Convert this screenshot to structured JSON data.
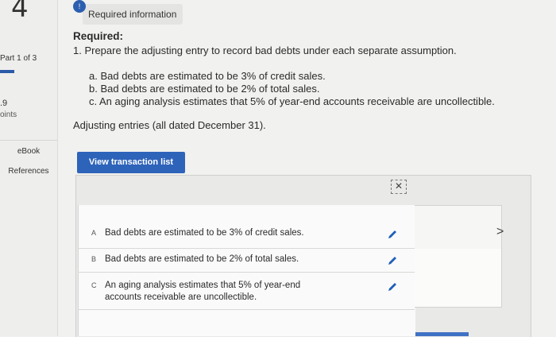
{
  "sidebar": {
    "question_number": "4",
    "part_label": "Part 1 of 3",
    "points_value": ".9",
    "points_label": "oints",
    "ebook_label": "eBook",
    "references_label": "References"
  },
  "header": {
    "info_badge": "!",
    "required_info_tab": "Required information"
  },
  "content": {
    "required_title": "Required:",
    "instruction": "1. Prepare the adjusting entry to record bad debts under each separate assumption.",
    "assumptions": [
      "a. Bad debts are estimated to be 3% of credit sales.",
      "b. Bad debts are estimated to be 2% of total sales.",
      "c. An aging analysis estimates that 5% of year-end accounts receivable are uncollectible."
    ],
    "adjusting_note": "Adjusting entries (all dated December 31)."
  },
  "worksheet": {
    "view_button": "View transaction list",
    "expand_icon": "expand-icon",
    "entries": [
      {
        "letter": "A",
        "text": "Bad debts are estimated to be 3% of credit sales."
      },
      {
        "letter": "B",
        "text": "Bad debts are estimated to be 2% of total sales."
      },
      {
        "letter": "C",
        "text": "An aging analysis estimates that 5% of year-end accounts receivable are uncollectible."
      }
    ],
    "next_chevron": ">"
  },
  "colors": {
    "accent": "#2e63ba",
    "pencil": "#1f5fb8"
  }
}
